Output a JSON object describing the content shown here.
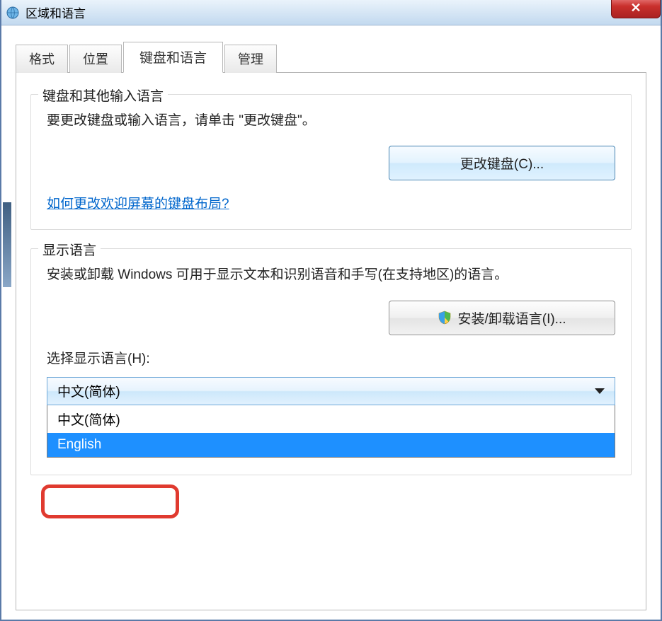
{
  "window": {
    "title": "区域和语言"
  },
  "tabs": [
    {
      "label": "格式"
    },
    {
      "label": "位置"
    },
    {
      "label": "键盘和语言"
    },
    {
      "label": "管理"
    }
  ],
  "activeTabIndex": 2,
  "keyboardSection": {
    "legend": "键盘和其他输入语言",
    "description": "要更改键盘或输入语言，请单击 \"更改键盘\"。",
    "changeKeyboardButton": "更改键盘(C)...",
    "welcomeLayoutLink": "如何更改欢迎屏幕的键盘布局?"
  },
  "displaySection": {
    "legend": "显示语言",
    "description": "安装或卸载 Windows 可用于显示文本和识别语音和手写(在支持地区)的语言。",
    "installButton": "安装/卸载语言(I)...",
    "selectLabel": "选择显示语言(H):",
    "selectedValue": "中文(简体)",
    "options": [
      "中文(简体)",
      "English"
    ],
    "highlightedOptionIndex": 1
  }
}
